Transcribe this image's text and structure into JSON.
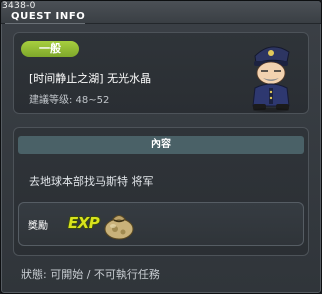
{
  "window": {
    "quest_id": "3438-0",
    "title": "QUEST INFO"
  },
  "quest": {
    "tag": "一般",
    "name": "[时间静止之湖] 无光水晶",
    "level_req": "建議等级: 48~52",
    "npc_icon": "police-officer-npc-portrait"
  },
  "content": {
    "header": "內容",
    "description": "去地球本部找马斯特 将军"
  },
  "reward": {
    "label": "獎勵",
    "exp_text": "EXP",
    "exp_icon": "exp-icon",
    "money_icon": "money-bag-icon"
  },
  "status": "狀態: 可開始 / 不可執行任務",
  "colors": {
    "tag_green": "#94bd35",
    "header_teal": "#4a6167",
    "exp_yellow": "#d8e31c"
  }
}
